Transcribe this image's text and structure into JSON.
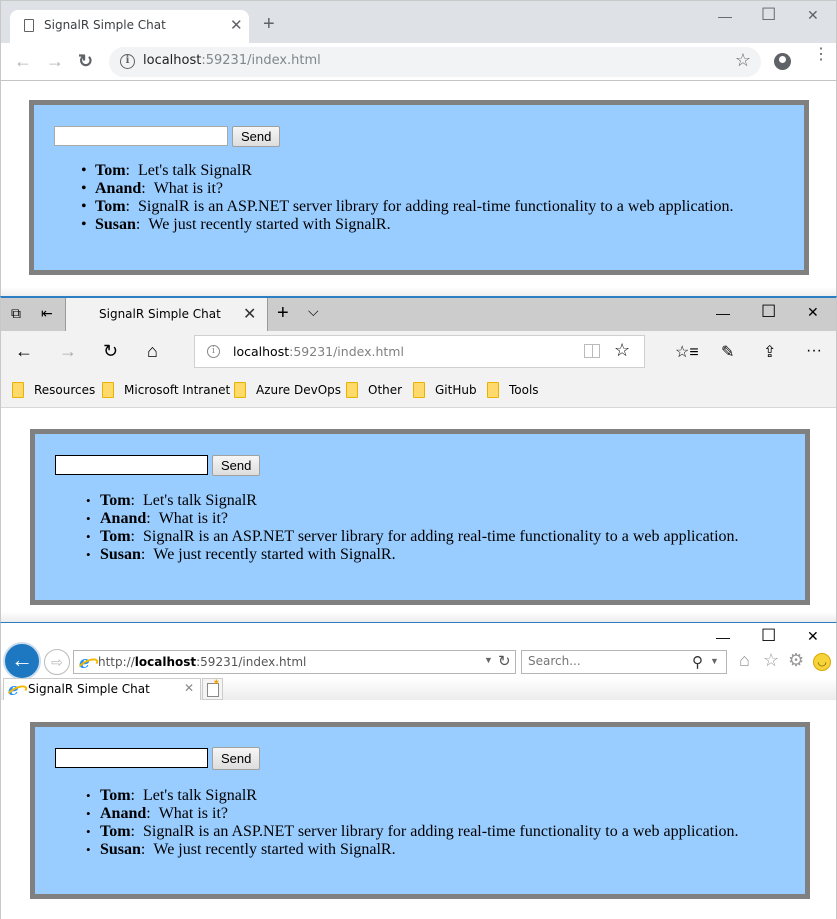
{
  "chat": {
    "send_label": "Send",
    "input_value": "",
    "messages": [
      {
        "name": "Tom",
        "text": "Let's talk SignalR"
      },
      {
        "name": "Anand",
        "text": "What is it?"
      },
      {
        "name": "Tom",
        "text": "SignalR is an ASP.NET server library for adding real-time functionality to a web application."
      },
      {
        "name": "Susan",
        "text": "We just recently started with SignalR."
      }
    ],
    "separator": ":"
  },
  "colors": {
    "chat_background": "#99ccff",
    "chat_border": "#808080",
    "edge_accent": "#2b7ec1",
    "folder": "#ffd96a"
  },
  "chrome": {
    "tab_title": "SignalR Simple Chat",
    "url_host": "localhost",
    "url_rest": ":59231/index.html",
    "icons": [
      "document-icon",
      "close-tab-icon",
      "new-tab-icon",
      "minimize-icon",
      "maximize-icon",
      "close-window-icon",
      "back-icon",
      "forward-icon",
      "reload-icon",
      "info-icon",
      "bookmark-star-icon",
      "account-icon",
      "menu-icon"
    ]
  },
  "edge": {
    "tab_title": "SignalR Simple Chat",
    "url_host": "localhost",
    "url_rest": ":59231/index.html",
    "favorites": [
      "Resources",
      "Microsoft Intranet",
      "Azure DevOps",
      "Other",
      "GitHub",
      "Tools"
    ]
  },
  "ie": {
    "tab_title": "SignalR Simple Chat",
    "url_prefix": "http://",
    "url_host": "localhost",
    "url_rest": ":59231/index.html",
    "search_placeholder": "Search..."
  },
  "glyphs": {
    "close": "✕",
    "plus": "+",
    "chevron_down": "⌵",
    "minimize": "—",
    "maximize": "☐",
    "back": "←",
    "forward": "→",
    "reload_chrome": "↻",
    "reload_edge": "↻",
    "home": "⌂",
    "star": "☆",
    "favorites": "☆≡",
    "pen": "✎",
    "share": "⇪",
    "more": "···",
    "ie_back": "←",
    "ie_fwd": "⇨",
    "search": "⚲",
    "dropdown": "▼",
    "ie_refresh": "↻",
    "gear": "⚙",
    "smile": "◡",
    "info": "i"
  }
}
